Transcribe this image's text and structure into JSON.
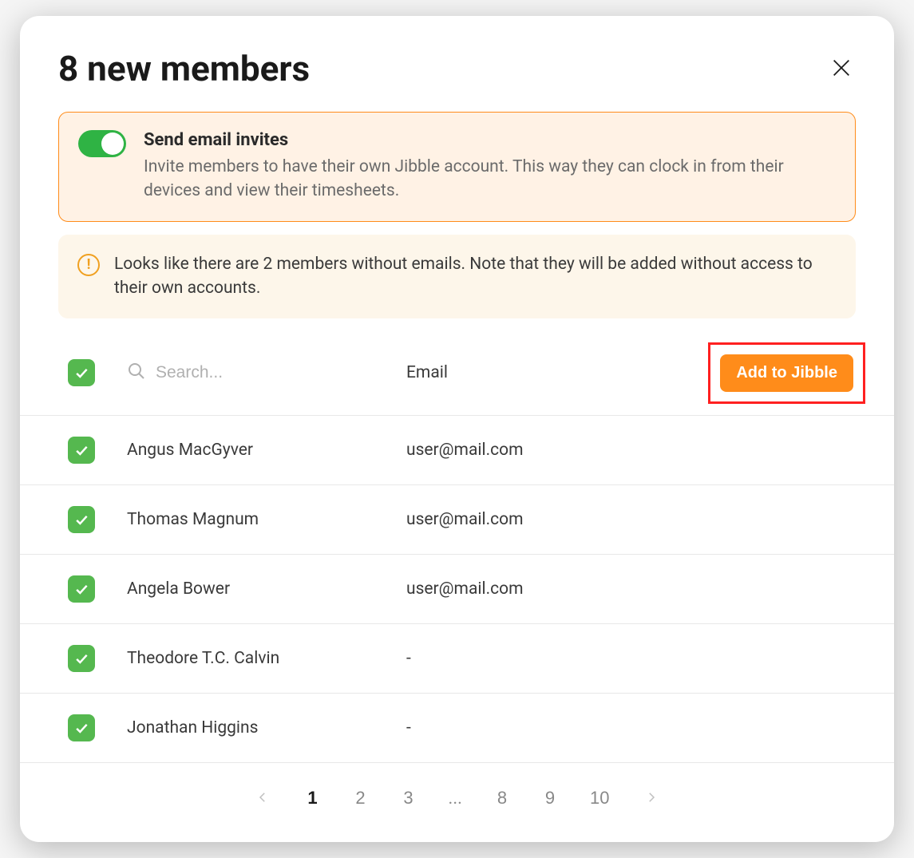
{
  "title": "8 new members",
  "invite": {
    "title": "Send email invites",
    "description": "Invite members to have their own Jibble account. This way they can clock in from their devices and view their timesheets.",
    "enabled": true
  },
  "warning": {
    "text": "Looks like there are 2 members without emails. Note that they will be added without access to their own accounts."
  },
  "search": {
    "placeholder": "Search..."
  },
  "columns": {
    "email": "Email"
  },
  "actions": {
    "add": "Add to Jibble"
  },
  "rows": [
    {
      "name": "Angus MacGyver",
      "email": "user@mail.com",
      "checked": true
    },
    {
      "name": "Thomas Magnum",
      "email": "user@mail.com",
      "checked": true
    },
    {
      "name": "Angela Bower",
      "email": "user@mail.com",
      "checked": true
    },
    {
      "name": "Theodore T.C. Calvin",
      "email": "-",
      "checked": true
    },
    {
      "name": "Jonathan Higgins",
      "email": "-",
      "checked": true
    }
  ],
  "pagination": {
    "pages": [
      "1",
      "2",
      "3",
      "...",
      "8",
      "9",
      "10"
    ],
    "current": "1"
  }
}
